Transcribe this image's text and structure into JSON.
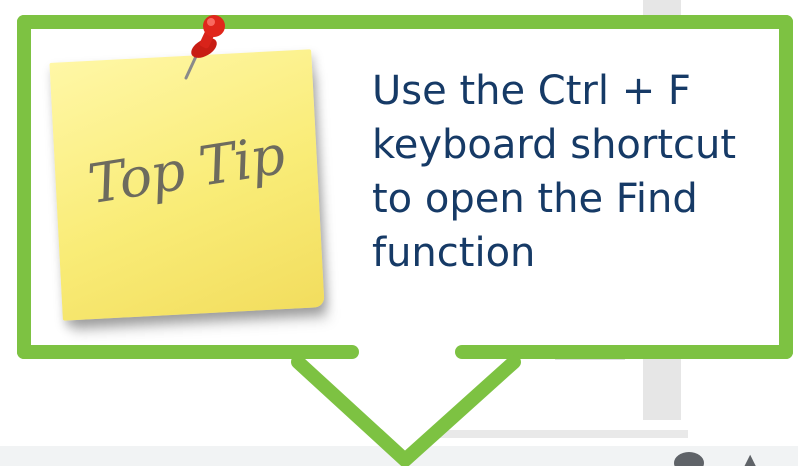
{
  "sticky_note": {
    "text": "Top Tip",
    "color": "#f9ec77",
    "pin_icon": "push-pin-icon",
    "pin_color": "#e0261b"
  },
  "tip": {
    "text": "Use the Ctrl + F keyboard shortcut to open the Find function",
    "color": "#163a66"
  },
  "callout": {
    "border_color": "#7dc242"
  }
}
